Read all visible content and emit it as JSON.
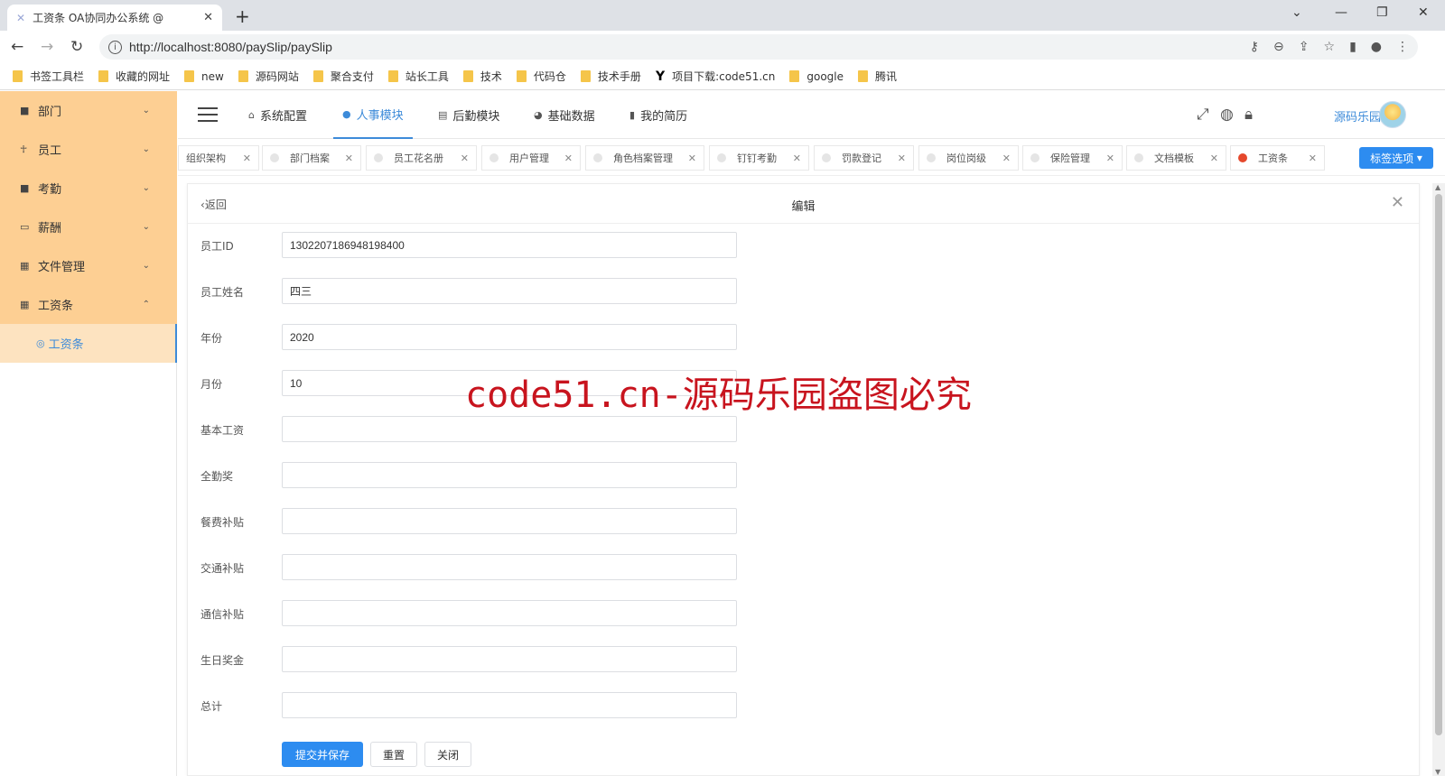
{
  "browser": {
    "tab_title": "工资条 OA协同办公系统 @",
    "url": "http://localhost:8080/paySlip/paySlip",
    "bookmarks": [
      "书签工具栏",
      "收藏的网址",
      "new",
      "源码网站",
      "聚合支付",
      "站长工具",
      "技术",
      "代码仓",
      "技术手册",
      "项目下载:code51.cn",
      "google",
      "腾讯"
    ]
  },
  "sidebar": {
    "items": [
      {
        "label": "部门",
        "icon": "square-icon"
      },
      {
        "label": "员工",
        "icon": "person-icon"
      },
      {
        "label": "考勤",
        "icon": "square-icon"
      },
      {
        "label": "薪酬",
        "icon": "wallet-icon"
      },
      {
        "label": "文件管理",
        "icon": "grid-icon"
      },
      {
        "label": "工资条",
        "icon": "grid-icon"
      }
    ],
    "sub_item": "工资条"
  },
  "topnav": {
    "items": [
      "系统配置",
      "人事模块",
      "后勤模块",
      "基础数据",
      "我的简历"
    ],
    "active": "人事模块",
    "username": "源码乐园"
  },
  "tabs": {
    "items": [
      "组织架构",
      "部门档案",
      "员工花名册",
      "用户管理",
      "角色档案管理",
      "钉钉考勤",
      "罚款登记",
      "岗位岗级",
      "保险管理",
      "文档模板",
      "工资条"
    ],
    "active": "工资条",
    "options_label": "标签选项"
  },
  "form": {
    "back_label": "返回",
    "title": "编辑",
    "fields": [
      {
        "label": "员工ID",
        "value": "1302207186948198400"
      },
      {
        "label": "员工姓名",
        "value": "四三"
      },
      {
        "label": "年份",
        "value": "2020"
      },
      {
        "label": "月份",
        "value": "10"
      },
      {
        "label": "基本工资",
        "value": ""
      },
      {
        "label": "全勤奖",
        "value": ""
      },
      {
        "label": "餐费补贴",
        "value": ""
      },
      {
        "label": "交通补贴",
        "value": ""
      },
      {
        "label": "通信补贴",
        "value": ""
      },
      {
        "label": "生日奖金",
        "value": ""
      },
      {
        "label": "总计",
        "value": ""
      }
    ],
    "buttons": {
      "submit": "提交并保存",
      "reset": "重置",
      "close": "关闭"
    }
  },
  "watermark": "code51.cn-源码乐园盗图必究",
  "colors": {
    "sidebar": "#fdcf93",
    "accent": "#3d8bd9",
    "primary_button": "#2d8cf0",
    "watermark": "#c8141e"
  }
}
